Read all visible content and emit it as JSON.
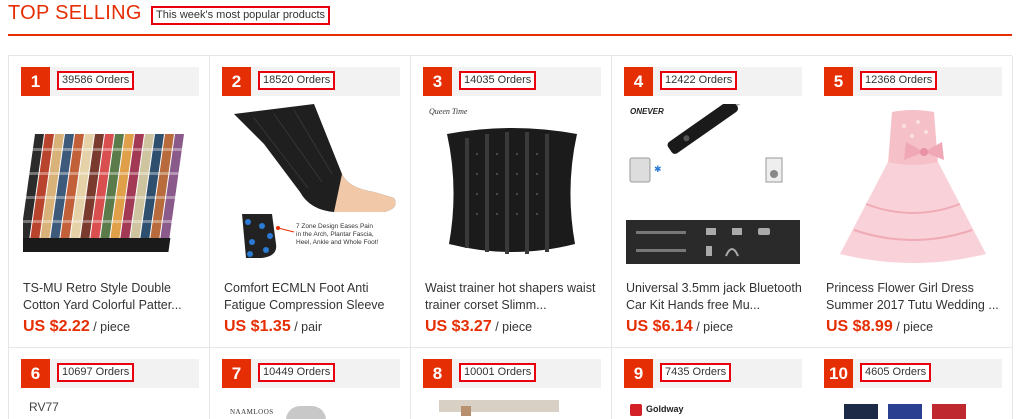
{
  "header": {
    "title": "TOP SELLING",
    "subtitle": "This week's most popular products"
  },
  "products": [
    {
      "rank": "1",
      "orders": "39586 Orders",
      "title": "TS-MU Retro Style Double Cotton Yard Colorful Patter...",
      "price": "US $2.22",
      "unit": "/ piece"
    },
    {
      "rank": "2",
      "orders": "18520 Orders",
      "title": "Comfort ECMLN Foot Anti Fatigue Compression Sleeve E...",
      "price": "US $1.35",
      "unit": "/ pair"
    },
    {
      "rank": "3",
      "orders": "14035 Orders",
      "title": "Waist trainer hot shapers waist trainer corset Slimm...",
      "price": "US $3.27",
      "unit": "/ piece"
    },
    {
      "rank": "4",
      "orders": "12422 Orders",
      "title": "Universal 3.5mm jack Bluetooth Car Kit Hands free Mu...",
      "price": "US $6.14",
      "unit": "/ piece"
    },
    {
      "rank": "5",
      "orders": "12368 Orders",
      "title": "Princess Flower Girl Dress Summer 2017 Tutu Wedding ...",
      "price": "US $8.99",
      "unit": "/ piece"
    },
    {
      "rank": "6",
      "orders": "10697 Orders"
    },
    {
      "rank": "7",
      "orders": "10449 Orders"
    },
    {
      "rank": "8",
      "orders": "10001 Orders"
    },
    {
      "rank": "9",
      "orders": "7435 Orders"
    },
    {
      "rank": "10",
      "orders": "4605 Orders"
    }
  ],
  "image_text": {
    "p2_caption": "7 Zone Design Eases Pain in the Arch, Plantar Fascia, Heel, Ankle and Whole Foot!",
    "p3_brand": "Queen Time",
    "p4_brand": "ONEVER",
    "p6_brand": "RV77",
    "p7_brand": "NAAMLOOS",
    "p9_brand": "Goldway"
  }
}
